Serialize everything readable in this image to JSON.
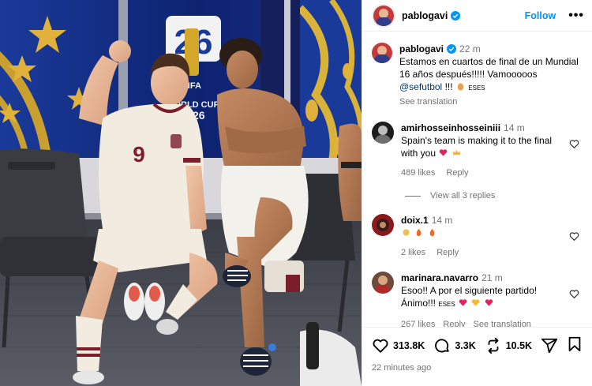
{
  "post": {
    "author": "pablogavi",
    "follow_label": "Follow",
    "more_label": "•••",
    "caption": {
      "time": "22 m",
      "text": "Estamos en cuartos de final de un Mundial 16 años después!!!!! Vamooooos",
      "mention": "@sefutbol",
      "tail": "!!!",
      "tail_flag": "ESES",
      "see_translation": "See translation"
    },
    "photo": {
      "banner_top": "26",
      "banner_fifa": "FIFA",
      "banner_wc": "WORLD CUP",
      "banner_year": "2026",
      "jersey_number": "9"
    }
  },
  "comments": [
    {
      "user": "amirhosseinhosseiniii",
      "time": "14 m",
      "text": "Spain's team is making it to the final with you",
      "likes": "489 likes",
      "reply": "Reply"
    },
    {
      "user": "doix.1",
      "time": "14 m",
      "text": "",
      "likes": "2 likes",
      "reply": "Reply"
    },
    {
      "user": "marinara.navarro",
      "time": "21 m",
      "text": "Esoo!! A por el siguiente partido! Ánimo!!!",
      "flag": "ESES",
      "likes": "267 likes",
      "reply": "Reply",
      "see_translation": "See translation"
    }
  ],
  "view_all_replies": "View all 3 replies",
  "actions": {
    "likes": "313.8K",
    "comments": "3.3K",
    "reposts": "10.5K"
  },
  "posted_ago": "22 minutes ago",
  "colors": {
    "link_blue": "#0095f6",
    "mention_blue": "#00376b",
    "muted": "#737373",
    "heart_red": "#ed4956"
  }
}
